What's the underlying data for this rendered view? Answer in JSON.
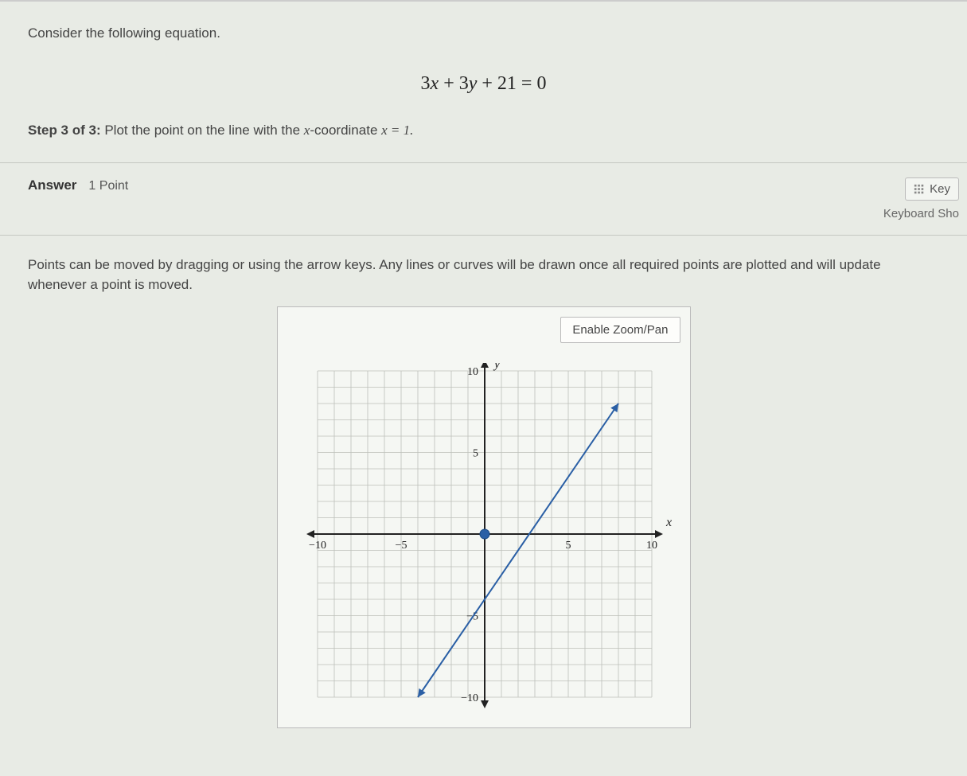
{
  "question": {
    "intro": "Consider the following equation.",
    "equation": "3x + 3y + 21 = 0",
    "step_label": "Step 3 of 3:",
    "step_text_prefix": " Plot the point on the line with the ",
    "step_var": "x",
    "step_text_mid": "-coordinate ",
    "step_condition": "x = 1.",
    "step_full": "Step 3 of 3: Plot the point on the line with the x-coordinate x = 1."
  },
  "answer_header": {
    "label": "Answer",
    "points": "1 Point",
    "key_button": "Key",
    "keyboard_hint": "Keyboard Sho"
  },
  "instructions": "Points can be moved by dragging or using the arrow keys. Any lines or curves will be drawn once all required points are plotted and will update whenever a point is moved.",
  "graph": {
    "zoom_label": "Enable Zoom/Pan",
    "axis_labels": {
      "x": "x",
      "y": "y",
      "ticks_x": [
        "-10",
        "-5",
        "5",
        "10"
      ],
      "ticks_y": [
        "10",
        "5",
        "-5",
        "-10"
      ]
    }
  },
  "chart_data": {
    "type": "line",
    "title": "",
    "xlabel": "x",
    "ylabel": "y",
    "xlim": [
      -10,
      10
    ],
    "ylim": [
      -10,
      10
    ],
    "grid": true,
    "series": [
      {
        "name": "line",
        "points": [
          [
            -4,
            -10
          ],
          [
            8,
            8
          ]
        ],
        "color": "#2a5fa5"
      }
    ],
    "plotted_points": [
      {
        "x": 0,
        "y": 0,
        "color": "#2a5fa5"
      }
    ]
  }
}
